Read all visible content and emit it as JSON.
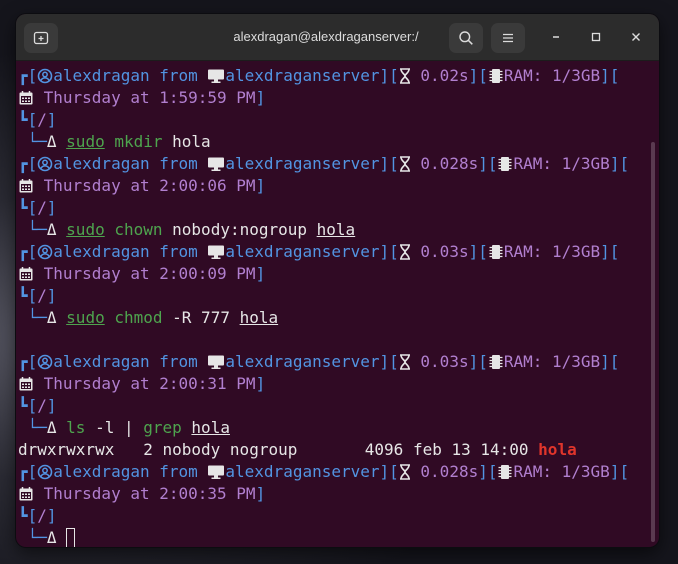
{
  "window": {
    "title": "alexdragan@alexdraganserver:/"
  },
  "colors": {
    "bg": "#300a24",
    "blue": "#5294e2",
    "purple": "#b17fcf",
    "green": "#4ea44e",
    "red": "#e0352b"
  },
  "terminal": {
    "prompts": [
      {
        "user": "alexdragan",
        "from": "from",
        "host": "alexdraganserver",
        "time": "0.02s",
        "ram": "RAM: 1/3GB",
        "date": "Thursday at 1:59:59 PM",
        "dir": "/",
        "delta": "Δ",
        "cmd_sudo": "sudo",
        "cmd": "mkdir",
        "args": "hola"
      },
      {
        "user": "alexdragan",
        "from": "from",
        "host": "alexdraganserver",
        "time": "0.028s",
        "ram": "RAM: 1/3GB",
        "date": "Thursday at 2:00:06 PM",
        "dir": "/",
        "delta": "Δ",
        "cmd_sudo": "sudo",
        "cmd": "chown",
        "args": "nobody:nogroup",
        "args2": "hola"
      },
      {
        "user": "alexdragan",
        "from": "from",
        "host": "alexdraganserver",
        "time": "0.03s",
        "ram": "RAM: 1/3GB",
        "date": "Thursday at 2:00:09 PM",
        "dir": "/",
        "delta": "Δ",
        "cmd_sudo": "sudo",
        "cmd": "chmod",
        "args": "-R 777",
        "args2": "hola"
      },
      {
        "user": "alexdragan",
        "from": "from",
        "host": "alexdraganserver",
        "time": "0.03s",
        "ram": "RAM: 1/3GB",
        "date": "Thursday at 2:00:31 PM",
        "dir": "/",
        "delta": "Δ",
        "cmd": "ls",
        "args": "-l |",
        "pipe_cmd": "grep",
        "args2": "hola"
      },
      {
        "user": "alexdragan",
        "from": "from",
        "host": "alexdraganserver",
        "time": "0.028s",
        "ram": "RAM: 1/3GB",
        "date": "Thursday at 2:00:35 PM",
        "dir": "/",
        "delta": "Δ"
      }
    ],
    "ls_output": {
      "perms": "drwxrwxrwx",
      "links": "2",
      "owner": "nobody",
      "group": "nogroup",
      "size": "4096",
      "date": "feb 13 14:00",
      "name": "hola"
    }
  },
  "icons": [
    "new-tab-icon",
    "search-icon",
    "menu-icon",
    "minimize-icon",
    "maximize-icon",
    "close-icon",
    "user-icon",
    "monitor-icon",
    "hourglass-icon",
    "memory-icon",
    "calendar-icon"
  ]
}
